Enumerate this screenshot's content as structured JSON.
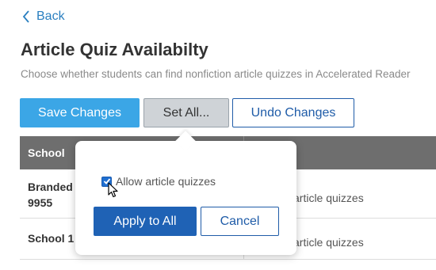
{
  "nav": {
    "back_label": "Back"
  },
  "page": {
    "title": "Article Quiz Availabilty",
    "subtitle": "Choose whether students can find nonfiction article quizzes in Accelerated Reader"
  },
  "toolbar": {
    "save_label": "Save Changes",
    "setall_label": "Set All...",
    "undo_label": "Undo Changes"
  },
  "table": {
    "headers": [
      "School",
      ""
    ],
    "rows": [
      {
        "school_line1": "Branded H",
        "school_line2": "9955",
        "quiz": "article quizzes"
      },
      {
        "school_line1": "School 1",
        "school_line2": "",
        "quiz": "article quizzes"
      }
    ]
  },
  "popover": {
    "checkbox_label": "Allow article quizzes",
    "checkbox_checked": true,
    "apply_label": "Apply to All",
    "cancel_label": "Cancel"
  },
  "colors": {
    "accent": "#3ba6e6",
    "primary": "#1f62b5",
    "link": "#2a7fc0",
    "header": "#6e6e6e"
  }
}
